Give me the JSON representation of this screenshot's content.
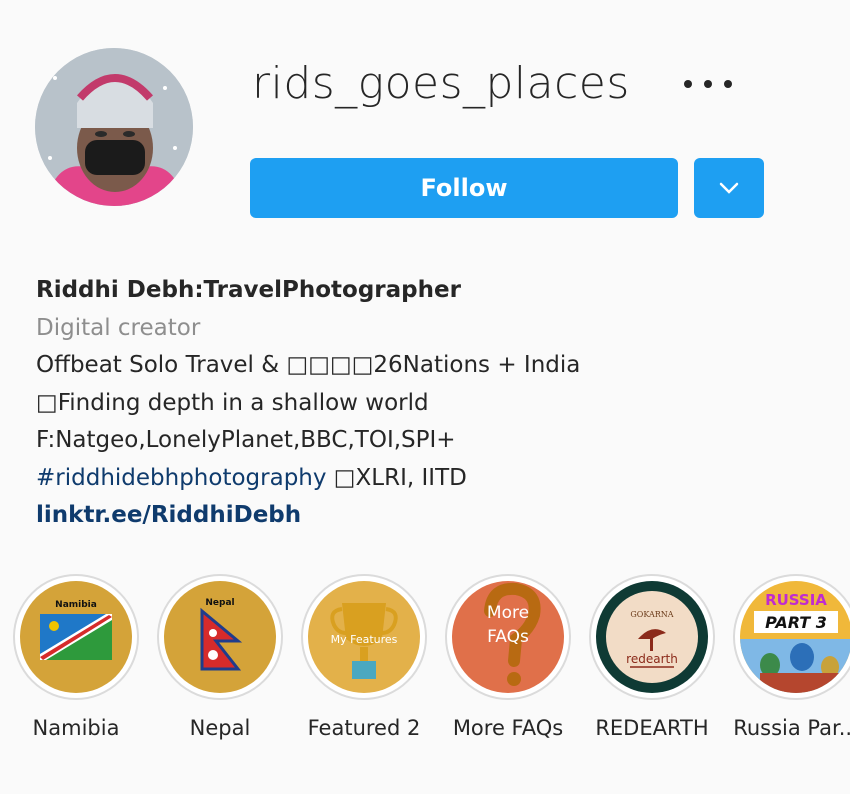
{
  "profile": {
    "username": "rids_goes_places",
    "follow_label": "Follow",
    "display_name": "Riddhi Debh:TravelPhotographer",
    "category": "Digital creator",
    "bio_line1": "Offbeat Solo Travel & □□□□26Nations + India",
    "bio_line2": "□Finding depth in a shallow world",
    "bio_line3": "F:Natgeo,LonelyPlanet,BBC,TOI,SPI+",
    "bio_hashtag": "#riddhidebhphotography",
    "bio_hashtag_rest": " □XLRI, IITD",
    "link": "linktr.ee/RiddhiDebh"
  },
  "highlights": [
    {
      "label": "Namibia",
      "cover_text": "Namibia",
      "bg": "#d4a339"
    },
    {
      "label": "Nepal",
      "cover_text": "Nepal",
      "bg": "#d4a339"
    },
    {
      "label": "Featured 2",
      "cover_text": "My Features",
      "bg": "#e3b14a"
    },
    {
      "label": "More FAQs",
      "cover_text": "More FAQs",
      "bg": "#e0704a"
    },
    {
      "label": "REDEARTH",
      "cover_text": "GOKARNA",
      "cover_text2": "redearth",
      "bg": "#0f3a34"
    },
    {
      "label": "Russia Par...",
      "cover_text": "RUSSIA",
      "cover_text2": "PART 3",
      "bg": "#f0b83a"
    }
  ],
  "colors": {
    "accent": "#1e9ff2",
    "link": "#0f3b6d",
    "muted": "#8e8e8e"
  },
  "icons": {
    "more": "more-horizontal-icon",
    "dropdown": "chevron-down-icon"
  }
}
